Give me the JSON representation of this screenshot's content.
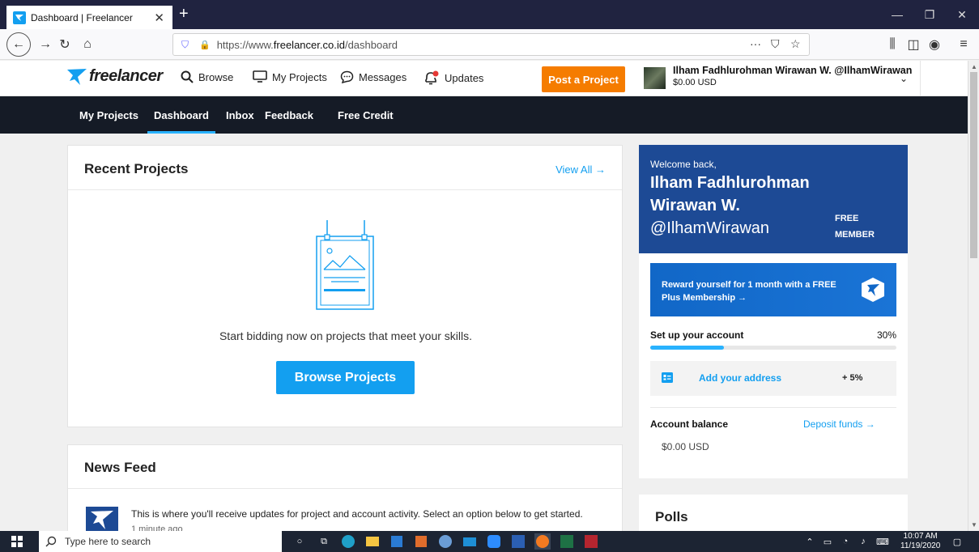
{
  "browser": {
    "tab_title": "Dashboard | Freelancer",
    "url_prefix": "https://www.",
    "url_domain": "freelancer.co.id",
    "url_path": "/dashboard"
  },
  "header": {
    "logo_text": "freelancer",
    "nav": {
      "browse": "Browse",
      "my_projects": "My Projects",
      "messages": "Messages",
      "updates": "Updates"
    },
    "post_button": "Post a Project",
    "user_name": "Ilham Fadhlurohman Wirawan W. @IlhamWirawan",
    "user_balance": "$0.00 USD"
  },
  "subnav": {
    "items": [
      "My Projects",
      "Dashboard",
      "Inbox",
      "Feedback",
      "Free Credit"
    ],
    "active": "Dashboard"
  },
  "recent_projects": {
    "title": "Recent Projects",
    "view_all": "View All →",
    "empty_message": "Start bidding now on projects that meet your skills.",
    "browse_button": "Browse Projects"
  },
  "news_feed": {
    "title": "News Feed",
    "item_text": "This is where you'll receive updates for project and account activity. Select an option below to get started.",
    "item_time": "1 minute ago"
  },
  "welcome": {
    "greeting": "Welcome back,",
    "name_line1": "Ilham Fadhlurohman",
    "name_line2": "Wirawan W.",
    "handle": "@IlhamWirawan",
    "badge_line1": "FREE",
    "badge_line2": "MEMBER"
  },
  "promo": {
    "line1": "Reward yourself for 1 month with a FREE",
    "line2": "Plus Membership →"
  },
  "setup": {
    "title": "Set up your account",
    "percent_label": "30%",
    "progress": 0.3,
    "task": "Add your address",
    "task_bonus": "+ 5%"
  },
  "balance": {
    "title": "Account balance",
    "deposit": "Deposit funds →",
    "amount": "$0.00 USD"
  },
  "polls": {
    "title": "Polls"
  },
  "taskbar": {
    "search_placeholder": "Type here to search",
    "time": "10:07 AM",
    "date": "11/19/2020"
  },
  "colors": {
    "brand_blue": "#139ff0",
    "orange": "#f57c00",
    "dark_nav": "#151b26",
    "welcome_blue": "#1d4a95"
  }
}
